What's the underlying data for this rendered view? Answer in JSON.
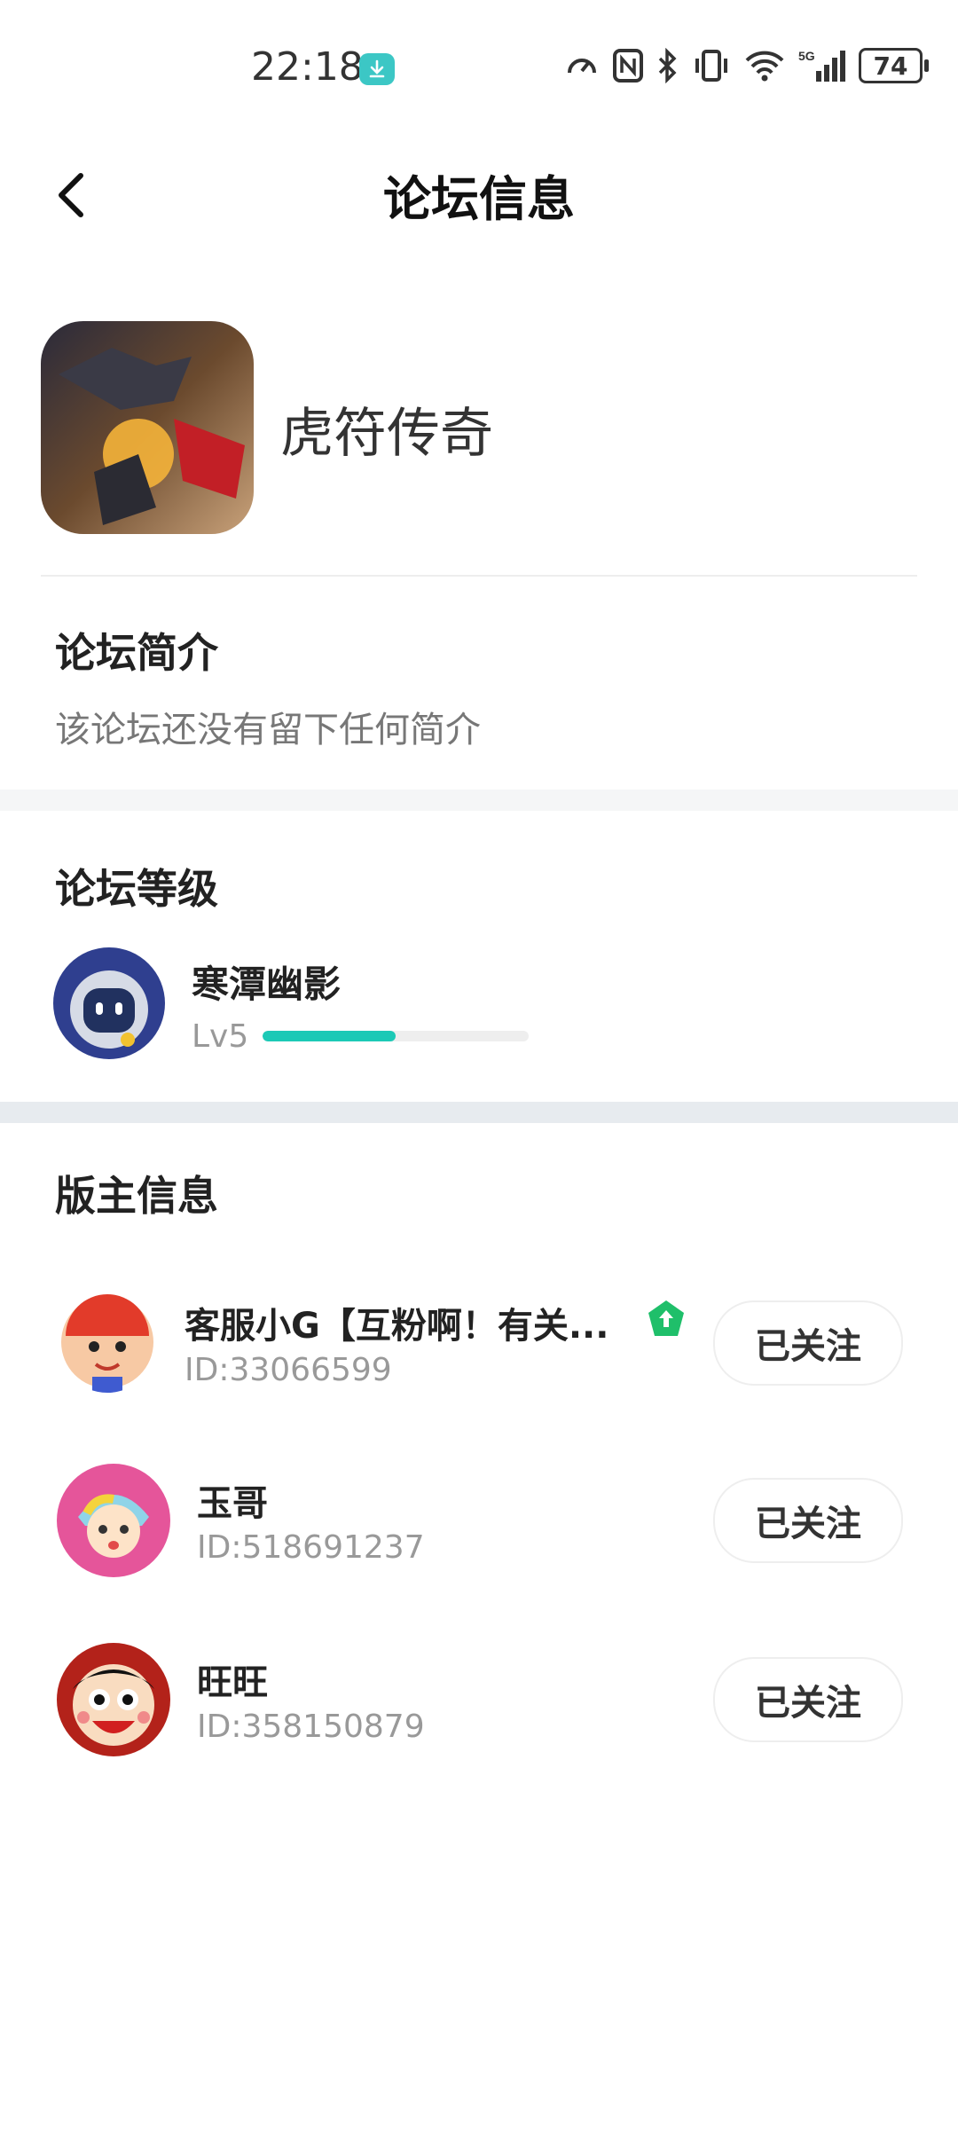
{
  "status_bar": {
    "time": "22:18",
    "battery": "74"
  },
  "header": {
    "title": "论坛信息"
  },
  "forum": {
    "name": "虎符传奇"
  },
  "intro": {
    "title": "论坛简介",
    "text": "该论坛还没有留下任何简介"
  },
  "level": {
    "title": "论坛等级",
    "user_name": "寒潭幽影",
    "level_label": "Lv5",
    "progress": 0.5
  },
  "moderators": {
    "title": "版主信息",
    "items": [
      {
        "name": "客服小G【互粉啊！有关...",
        "id": "ID:33066599",
        "button": "已关注"
      },
      {
        "name": "玉哥",
        "id": "ID:518691237",
        "button": "已关注"
      },
      {
        "name": "旺旺",
        "id": "ID:358150879",
        "button": "已关注"
      }
    ]
  },
  "colors": {
    "accent": "#1cc9b6",
    "badge": "#1fbf6a"
  }
}
